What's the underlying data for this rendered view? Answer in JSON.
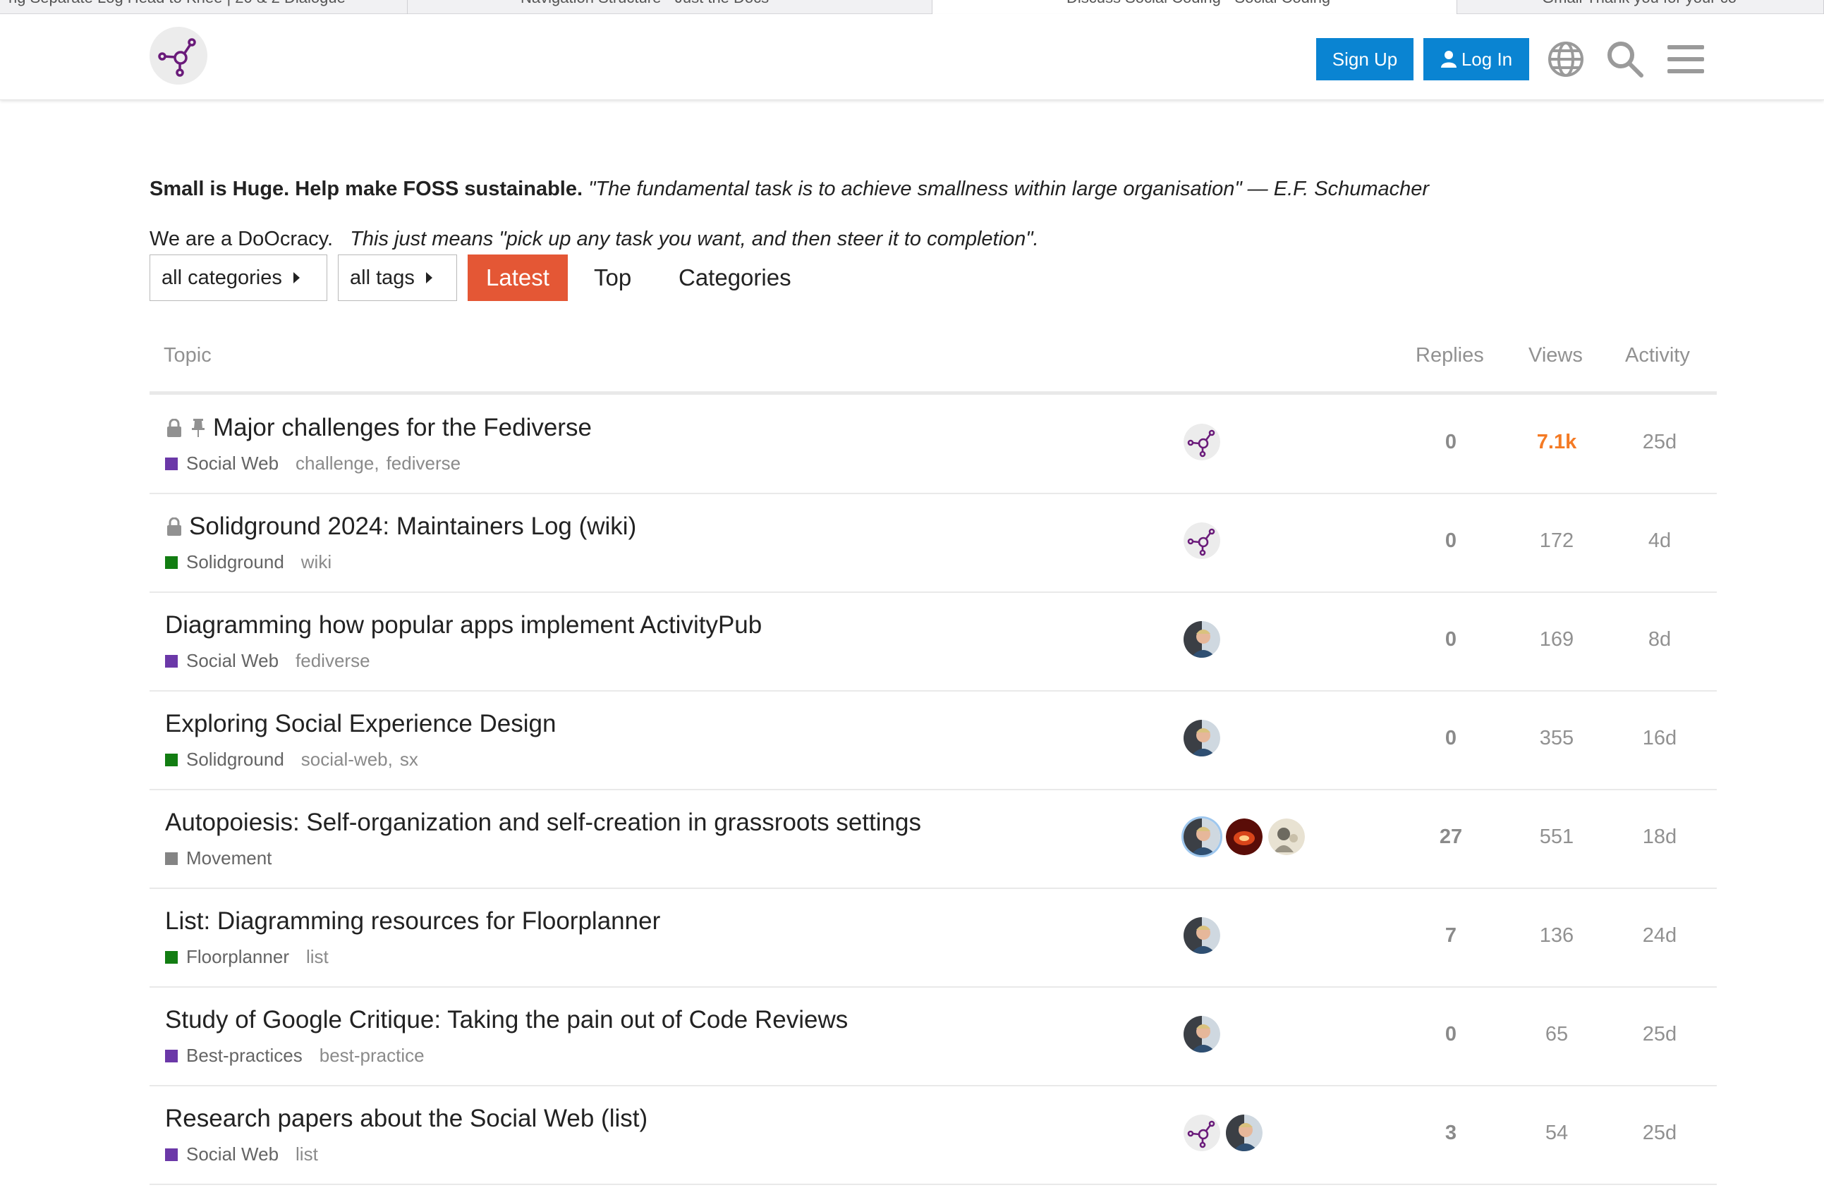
{
  "browser_tabs": [
    {
      "label": "ng Separate Log Head to Knee | 20 & 2 Dialogue"
    },
    {
      "label": "Navigation Structure - Just the Docs"
    },
    {
      "label": "Discuss Social Coding - Social Coding"
    },
    {
      "label": "Gmail    Thank you for your co"
    }
  ],
  "header": {
    "signup_label": "Sign Up",
    "login_label": "Log In",
    "icons": [
      "logo-icon",
      "user-icon",
      "globe-icon",
      "search-icon",
      "hamburger-menu-icon"
    ]
  },
  "banner": {
    "bold": "Small is Huge. Help make FOSS sustainable.",
    "quote": "\"The fundamental task is to achieve smallness within large organisation\" — E.F. Schumacher",
    "line2_plain": "We are a DoOcracy.",
    "line2_italic": "This just means \"pick up any task you want, and then steer it to completion\"."
  },
  "nav": {
    "categories_dropdown": "all categories",
    "tags_dropdown": "all tags",
    "tabs": [
      "Latest",
      "Top",
      "Categories"
    ],
    "active_tab": "Latest"
  },
  "table": {
    "columns": {
      "topic": "Topic",
      "replies": "Replies",
      "views": "Views",
      "activity": "Activity"
    },
    "rows": [
      {
        "title": "Major challenges for the Fediverse",
        "locked": true,
        "pinned": true,
        "category": "Social Web",
        "category_color": "#6b38a8",
        "tags": [
          "challenge",
          "fediverse"
        ],
        "posters": [
          "logo"
        ],
        "replies": "0",
        "views": "7.1k",
        "views_hot": true,
        "activity": "25d"
      },
      {
        "title": "Solidground 2024: Maintainers Log (wiki)",
        "locked": true,
        "pinned": false,
        "category": "Solidground",
        "category_color": "#127d12",
        "tags": [
          "wiki"
        ],
        "posters": [
          "logo"
        ],
        "replies": "0",
        "views": "172",
        "views_hot": false,
        "activity": "4d"
      },
      {
        "title": "Diagramming how popular apps implement ActivityPub",
        "locked": false,
        "pinned": false,
        "category": "Social Web",
        "category_color": "#6b38a8",
        "tags": [
          "fediverse"
        ],
        "posters": [
          "person"
        ],
        "replies": "0",
        "views": "169",
        "views_hot": false,
        "activity": "8d"
      },
      {
        "title": "Exploring Social Experience Design",
        "locked": false,
        "pinned": false,
        "category": "Solidground",
        "category_color": "#127d12",
        "tags": [
          "social-web",
          "sx"
        ],
        "posters": [
          "person"
        ],
        "replies": "0",
        "views": "355",
        "views_hot": false,
        "activity": "16d"
      },
      {
        "title": "Autopoiesis: Self-organization and self-creation in grassroots settings",
        "locked": false,
        "pinned": false,
        "category": "Movement",
        "category_color": "#848484",
        "tags": [],
        "posters": [
          "person-ring",
          "fire",
          "photo"
        ],
        "replies": "27",
        "views": "551",
        "views_hot": false,
        "activity": "18d"
      },
      {
        "title": "List: Diagramming resources for Floorplanner",
        "locked": false,
        "pinned": false,
        "category": "Floorplanner",
        "category_color": "#127d12",
        "tags": [
          "list"
        ],
        "posters": [
          "person"
        ],
        "replies": "7",
        "views": "136",
        "views_hot": false,
        "activity": "24d"
      },
      {
        "title": "Study of Google Critique: Taking the pain out of Code Reviews",
        "locked": false,
        "pinned": false,
        "category": "Best-practices",
        "category_color": "#6b38a8",
        "tags": [
          "best-practice"
        ],
        "posters": [
          "person"
        ],
        "replies": "0",
        "views": "65",
        "views_hot": false,
        "activity": "25d"
      },
      {
        "title": "Research papers about the Social Web (list)",
        "locked": false,
        "pinned": false,
        "category": "Social Web",
        "category_color": "#6b38a8",
        "tags": [
          "list"
        ],
        "posters": [
          "logo",
          "person"
        ],
        "replies": "3",
        "views": "54",
        "views_hot": false,
        "activity": "25d"
      }
    ]
  },
  "colors": {
    "accent_blue": "#0a84d2",
    "latest_orange": "#e45735",
    "hot_views": "#f47a24",
    "logo_purple": "#6a1b7a"
  }
}
